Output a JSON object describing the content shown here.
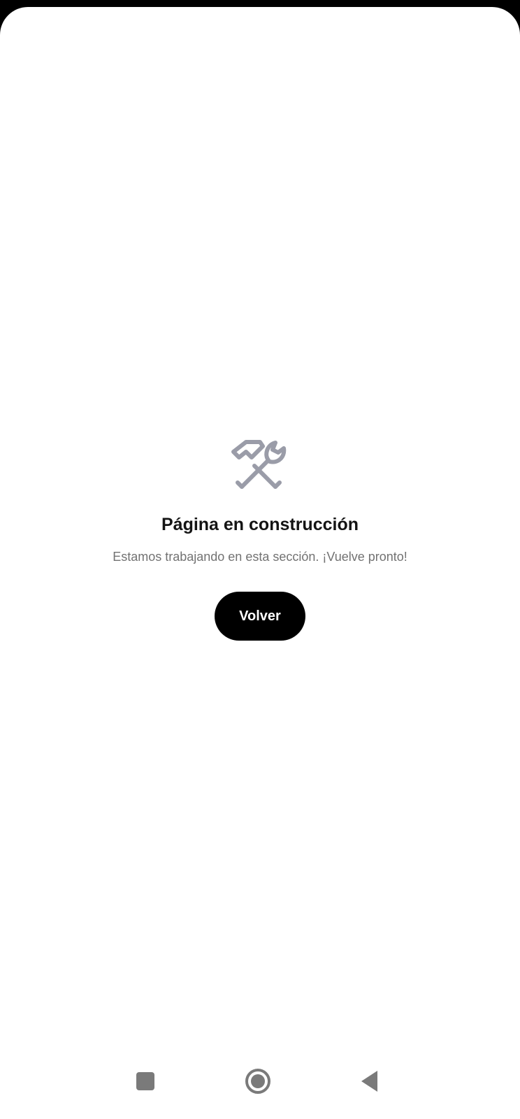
{
  "page": {
    "title": "Página en construcción",
    "subtitle": "Estamos trabajando en esta sección. ¡Vuelve pronto!",
    "back_button_label": "Volver",
    "icon": "hammer-wrench-icon"
  },
  "colors": {
    "background": "#ffffff",
    "icon": "#9a9ca8",
    "button_bg": "#000000",
    "button_text": "#ffffff",
    "title": "#141414",
    "subtitle": "#727272",
    "nav_icons": "#7a7a7a"
  },
  "system_nav": {
    "items": [
      "recents-icon",
      "home-icon",
      "back-icon"
    ]
  }
}
